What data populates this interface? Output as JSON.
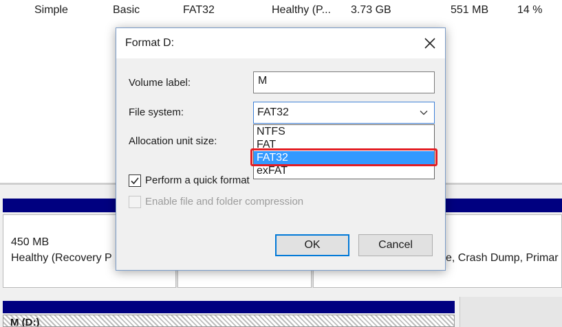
{
  "volume_row": {
    "layout": "Simple",
    "type": "Basic",
    "file_system": "FAT32",
    "status": "Healthy (P...",
    "capacity": "3.73 GB",
    "free_space": "551 MB",
    "percent_free": "14 %"
  },
  "disk_map": {
    "partition_size": "450 MB",
    "partition_status": "Healthy (Recovery P",
    "partition_status_right": "e, Crash Dump, Primar",
    "volume_label": "M (D:)"
  },
  "dialog": {
    "title": "Format D:",
    "volume_label": {
      "label": "Volume label:",
      "value": "M"
    },
    "file_system": {
      "label": "File system:",
      "selected": "FAT32",
      "options": [
        "NTFS",
        "FAT",
        "FAT32",
        "exFAT"
      ],
      "highlighted": "FAT32"
    },
    "allocation_unit": {
      "label": "Allocation unit size:"
    },
    "quick_format": {
      "label": "Perform a quick format",
      "checked": true
    },
    "compression": {
      "label": "Enable file and folder compression",
      "checked": false,
      "enabled": false
    },
    "ok_label": "OK",
    "cancel_label": "Cancel"
  },
  "colors": {
    "selection": "#3399ff",
    "highlight_outline": "#e31e24",
    "disk_bar": "#000080",
    "default_button_border": "#0078d7"
  },
  "icons": {
    "close": "close-icon",
    "dropdown": "chevron-down-icon",
    "check": "checkmark-icon"
  }
}
